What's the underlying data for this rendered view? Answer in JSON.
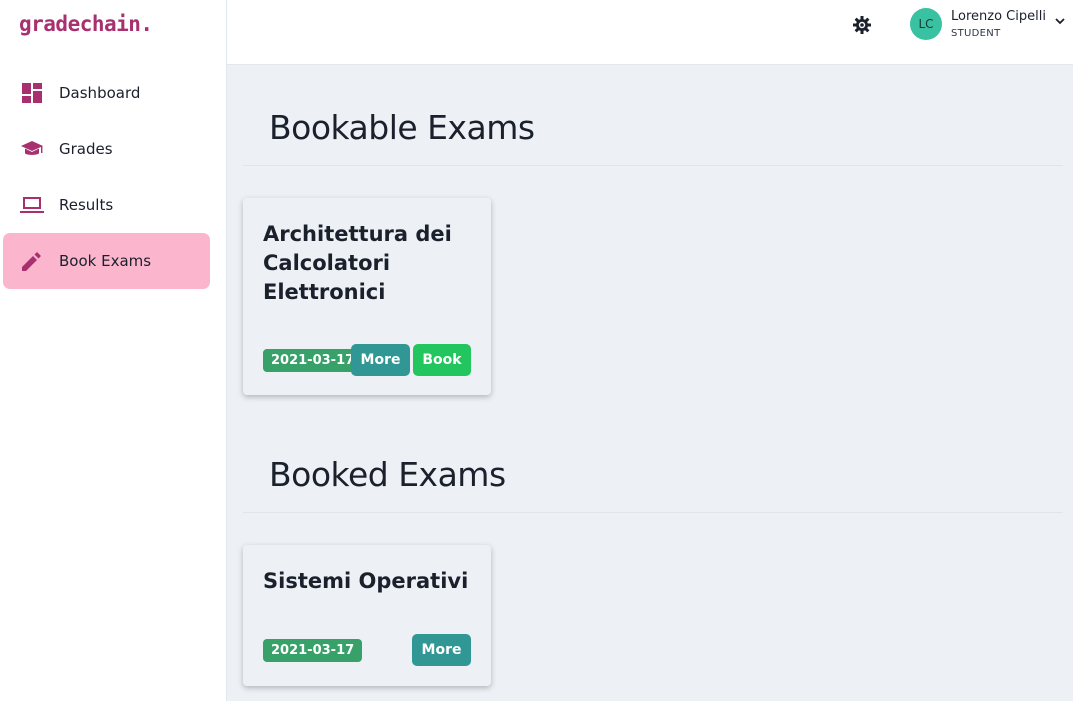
{
  "brand": "gradechain.",
  "sidebar": {
    "items": [
      {
        "label": "Dashboard",
        "icon": "dashboard-icon"
      },
      {
        "label": "Grades",
        "icon": "graduation-cap-icon"
      },
      {
        "label": "Results",
        "icon": "laptop-icon"
      },
      {
        "label": "Book Exams",
        "icon": "pencil-icon",
        "active": true
      }
    ]
  },
  "header": {
    "settings_icon": "gear-icon",
    "user": {
      "initials": "LC",
      "name": "Lorenzo Cipelli",
      "role": "STUDENT"
    }
  },
  "bookable": {
    "title": "Bookable Exams",
    "exams": [
      {
        "name": "Architettura dei Calcolatori Elettronici",
        "date": "2021-03-17",
        "more_label": "More",
        "book_label": "Book"
      }
    ]
  },
  "booked": {
    "title": "Booked Exams",
    "exams": [
      {
        "name": "Sistemi Operativi",
        "date": "2021-03-17",
        "more_label": "More"
      }
    ]
  },
  "colors": {
    "brand": "#a8306e",
    "active_nav": "#fbb6ce",
    "badge": "#38a169",
    "more": "#319795",
    "book": "#22c55e",
    "avatar": "#38c2a1"
  }
}
